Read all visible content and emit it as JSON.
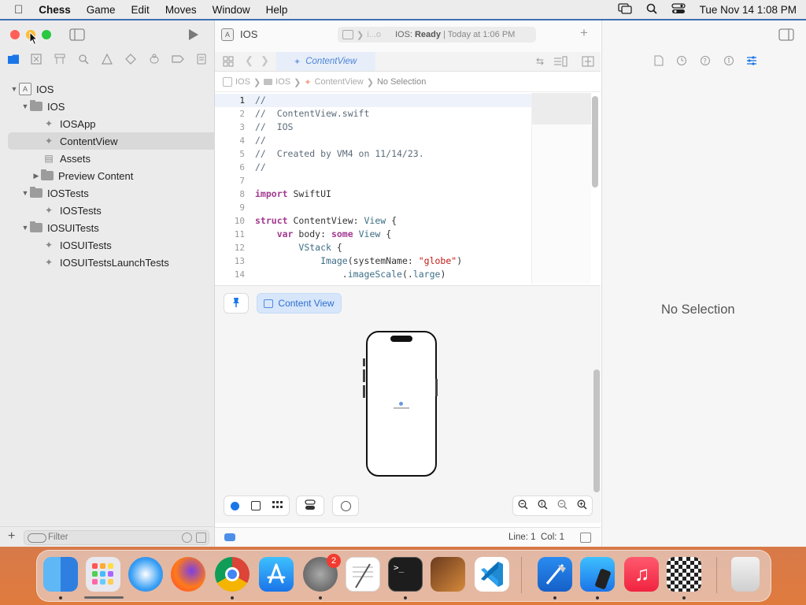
{
  "menubar": {
    "apple": "",
    "items": [
      "Chess",
      "Game",
      "Edit",
      "Moves",
      "Window",
      "Help"
    ],
    "clock": "Tue Nov 14  1:08 PM"
  },
  "window": {
    "project_title": "IOS",
    "status_project": "IOS:",
    "status_state": "Ready",
    "status_time": "| Today at 1:06 PM",
    "scheme_faded": "i...o"
  },
  "navigator": {
    "tree": [
      {
        "label": "IOS",
        "kind": "project",
        "level": 0,
        "expanded": true
      },
      {
        "label": "IOS",
        "kind": "folder",
        "level": 1,
        "expanded": true
      },
      {
        "label": "IOSApp",
        "kind": "swift",
        "level": 2
      },
      {
        "label": "ContentView",
        "kind": "swift",
        "level": 2,
        "selected": true
      },
      {
        "label": "Assets",
        "kind": "assets",
        "level": 2
      },
      {
        "label": "Preview Content",
        "kind": "folder",
        "level": 2,
        "expanded": false
      },
      {
        "label": "IOSTests",
        "kind": "folder",
        "level": 1,
        "expanded": true
      },
      {
        "label": "IOSTests",
        "kind": "swift",
        "level": 2
      },
      {
        "label": "IOSUITests",
        "kind": "folder",
        "level": 1,
        "expanded": true
      },
      {
        "label": "IOSUITests",
        "kind": "swift",
        "level": 2
      },
      {
        "label": "IOSUITestsLaunchTests",
        "kind": "swift",
        "level": 2
      }
    ],
    "filter_placeholder": "Filter"
  },
  "editor": {
    "tab_label": "ContentView",
    "jumpbar": [
      "IOS",
      "IOS",
      "ContentView",
      "No Selection"
    ],
    "code": [
      {
        "n": "1",
        "t": "//"
      },
      {
        "n": "2",
        "t": "//  ContentView.swift"
      },
      {
        "n": "3",
        "t": "//  IOS"
      },
      {
        "n": "4",
        "t": "//"
      },
      {
        "n": "5",
        "t": "//  Created by VM4 on 11/14/23."
      },
      {
        "n": "6",
        "t": "//"
      },
      {
        "n": "7",
        "t": ""
      },
      {
        "n": "8",
        "t": "import SwiftUI"
      },
      {
        "n": "9",
        "t": ""
      },
      {
        "n": "10",
        "t": "struct ContentView: View {"
      },
      {
        "n": "11",
        "t": "    var body: some View {"
      },
      {
        "n": "12",
        "t": "        VStack {"
      },
      {
        "n": "13",
        "t": "            Image(systemName: \"globe\")"
      },
      {
        "n": "14",
        "t": "                .imageScale(.large)"
      }
    ]
  },
  "canvas": {
    "preview_label": "Content View"
  },
  "status": {
    "line": "Line: 1",
    "col": "Col: 1"
  },
  "inspector": {
    "empty_text": "No Selection"
  },
  "dock": {
    "badge_settings": "2",
    "apps": [
      "finder",
      "launchpad",
      "safari",
      "firefox",
      "chrome",
      "app-store",
      "system-settings",
      "textedit",
      "terminal",
      "garageband",
      "vscode",
      "xcode",
      "simulator",
      "music",
      "chess",
      "trash"
    ]
  },
  "colors": {
    "accent": "#1a76e8",
    "close": "#ff5f57",
    "minimize": "#febc2e",
    "zoom": "#28c840",
    "selection": "#d9d9d9",
    "keyword": "#a23a8f",
    "string": "#c41a16"
  }
}
